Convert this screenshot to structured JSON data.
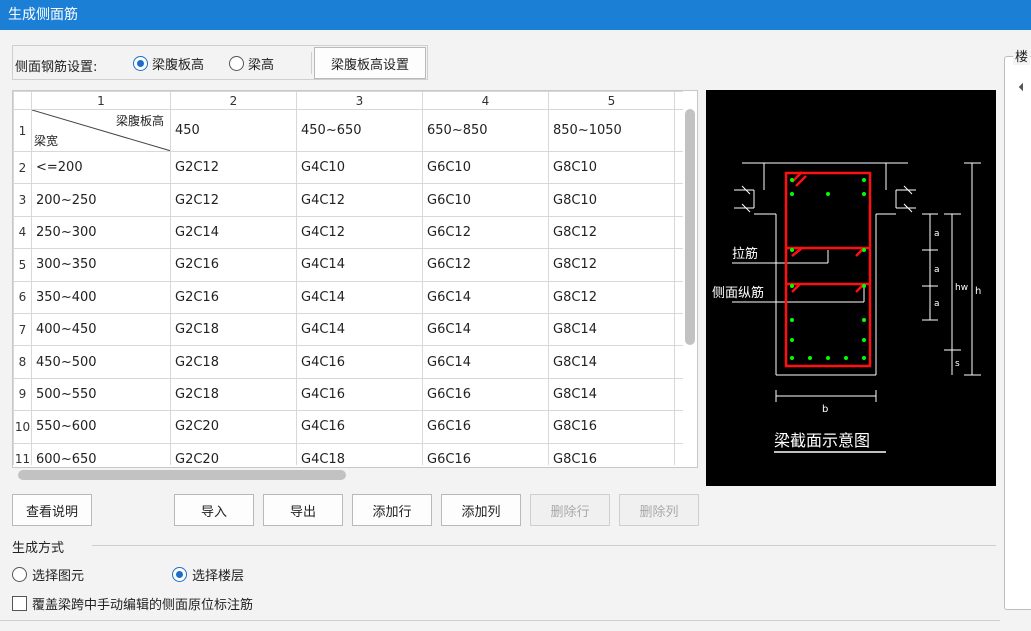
{
  "window": {
    "title": "生成侧面筋"
  },
  "settings": {
    "label": "侧面钢筋设置:",
    "option_web_height": "梁腹板高",
    "option_beam_height": "梁高",
    "web_height_settings_button": "梁腹板高设置"
  },
  "grid": {
    "col_headers": [
      "1",
      "2",
      "3",
      "4",
      "5"
    ],
    "corner_top": "梁腹板高",
    "corner_bottom": "梁宽",
    "first_row": [
      "450",
      "450~650",
      "650~850",
      "850~1050"
    ],
    "rows": [
      {
        "num": "1"
      },
      {
        "num": "2",
        "cells": [
          "<=200",
          "G2C12",
          "G4C10",
          "G6C10",
          "G8C10"
        ]
      },
      {
        "num": "3",
        "cells": [
          "200~250",
          "G2C12",
          "G4C12",
          "G6C10",
          "G8C10"
        ]
      },
      {
        "num": "4",
        "cells": [
          "250~300",
          "G2C14",
          "G4C12",
          "G6C12",
          "G8C12"
        ]
      },
      {
        "num": "5",
        "cells": [
          "300~350",
          "G2C16",
          "G4C14",
          "G6C12",
          "G8C12"
        ]
      },
      {
        "num": "6",
        "cells": [
          "350~400",
          "G2C16",
          "G4C14",
          "G6C14",
          "G8C12"
        ]
      },
      {
        "num": "7",
        "cells": [
          "400~450",
          "G2C18",
          "G4C14",
          "G6C14",
          "G8C14"
        ]
      },
      {
        "num": "8",
        "cells": [
          "450~500",
          "G2C18",
          "G4C16",
          "G6C14",
          "G8C14"
        ]
      },
      {
        "num": "9",
        "cells": [
          "500~550",
          "G2C18",
          "G4C16",
          "G6C16",
          "G8C14"
        ]
      },
      {
        "num": "10",
        "cells": [
          "550~600",
          "G2C20",
          "G4C16",
          "G6C16",
          "G8C16"
        ]
      },
      {
        "num": "11",
        "cells": [
          "600~650",
          "G2C20",
          "G4C18",
          "G6C16",
          "G8C16"
        ]
      }
    ]
  },
  "diagram": {
    "label_tie": "拉筋",
    "label_side_rebar": "侧面纵筋",
    "label_a": "a",
    "label_hw": "hw",
    "label_h": "h",
    "label_s": "s",
    "label_b": "b",
    "caption": "梁截面示意图"
  },
  "buttons": {
    "view_help": "查看说明",
    "import": "导入",
    "export": "导出",
    "add_row": "添加行",
    "add_col": "添加列",
    "delete_row": "删除行",
    "delete_col": "删除列"
  },
  "generation": {
    "title": "生成方式",
    "select_element": "选择图元",
    "select_floor": "选择楼层",
    "overwrite_label": "覆盖梁跨中手动编辑的侧面原位标注筋"
  },
  "floor_panel": {
    "title": "楼"
  }
}
